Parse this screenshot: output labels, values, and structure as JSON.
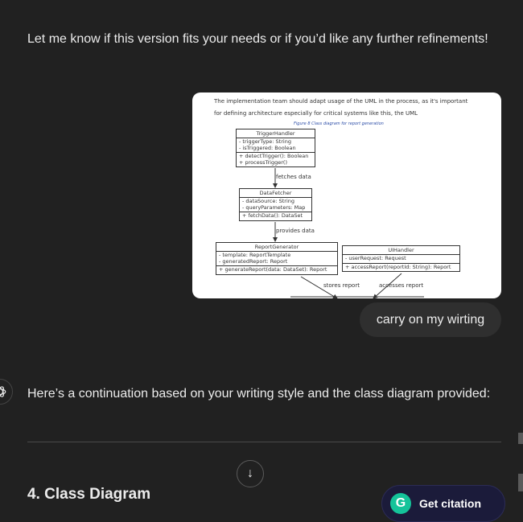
{
  "assistant_top": {
    "text": "Let me know if this version fits your needs or if you’d like any further refinements!"
  },
  "attachment": {
    "paragraph_lines": [
      "The implementation team should adapt usage of the UML in the process, as it's important",
      "for defining architecture especially for critical systems like this, the UML"
    ],
    "caption": "Figure 8 Class diagram for report generation",
    "classes": {
      "trigger": {
        "name": "TriggerHandler",
        "attributes": [
          "- triggerType: String",
          "- isTriggered: Boolean"
        ],
        "methods": [
          "+ detectTrigger(): Boolean",
          "+ processTrigger()"
        ]
      },
      "fetcher": {
        "name": "DataFetcher",
        "attributes": [
          "- dataSource: String",
          "- queryParameters: Map"
        ],
        "methods": [
          "+ fetchData(): DataSet"
        ]
      },
      "generator": {
        "name": "ReportGenerator",
        "attributes": [
          "- template: ReportTemplate",
          "- generatedReport: Report"
        ],
        "methods": [
          "+ generateReport(data: DataSet): Report"
        ]
      },
      "ui": {
        "name": "UIHandler",
        "attributes": [
          "- userRequest: Request"
        ],
        "methods": [
          "+ accessReport(reportId: String): Report"
        ]
      }
    },
    "relations": {
      "fetches": "fetches data",
      "provides": "provides data",
      "stores": "stores report",
      "accesses": "accesses report"
    }
  },
  "user_message": {
    "text": "carry on my wirting"
  },
  "assistant_reply": {
    "intro": "Here’s a continuation based on your writing style and the class diagram provided:",
    "heading": "4. Class Diagram"
  },
  "scroll_button": {
    "icon": "arrow-down-icon",
    "glyph": "↓"
  },
  "citation_button": {
    "label": "Get citation",
    "logo_letter": "G",
    "logo_color": "#15c39a"
  },
  "icons": {
    "assistant": "openai-logo-icon"
  }
}
